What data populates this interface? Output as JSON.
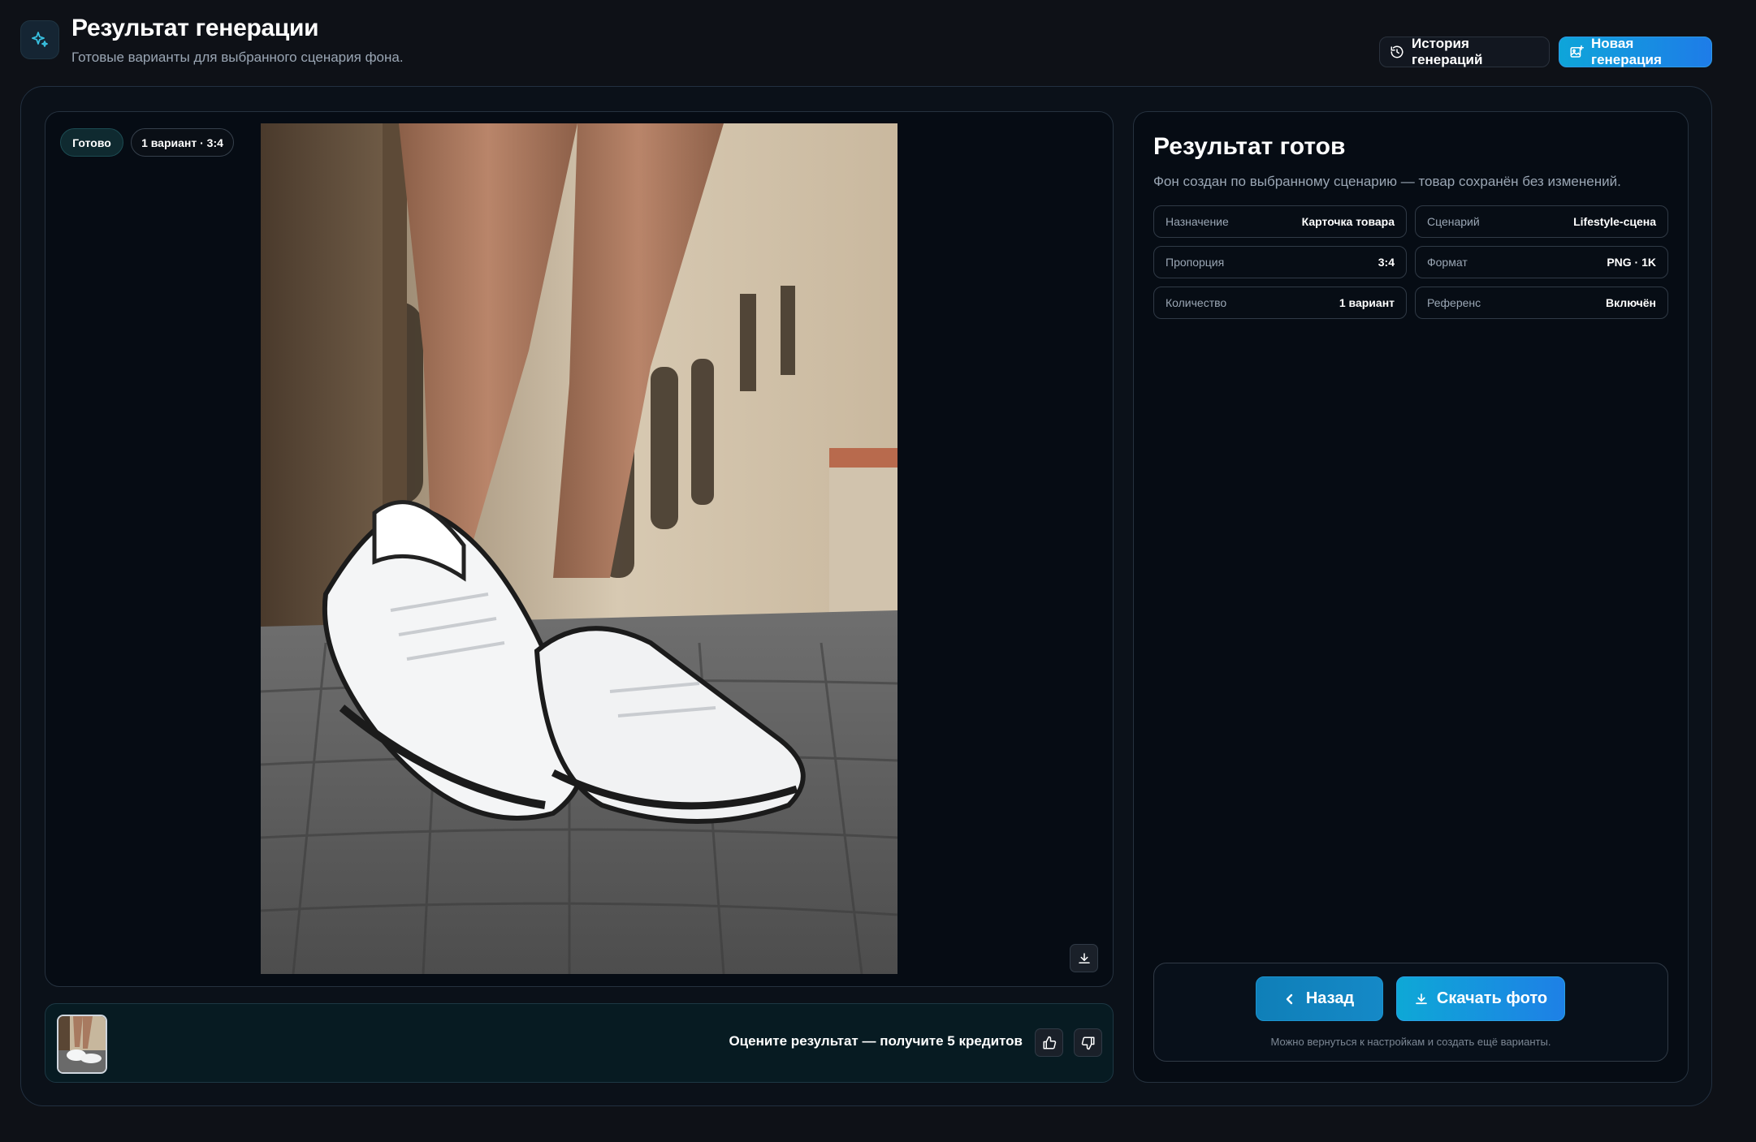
{
  "header": {
    "title": "Результат генерации",
    "subtitle": "Готовые варианты для выбранного сценария фона.",
    "app_icon": "sparkles-icon",
    "history_button": "История генераций",
    "history_icon": "history-icon",
    "new_button": "Новая генерация",
    "new_icon": "image-plus-icon"
  },
  "preview": {
    "status_chip": "Готово",
    "variant_chip": "1 вариант · 3:4",
    "image_alt": "White sneakers on cobblestone street",
    "download_icon": "download-icon"
  },
  "rating": {
    "text": "Оцените результат — получите 5 кредитов",
    "like_icon": "thumbs-up-icon",
    "dislike_icon": "thumbs-down-icon"
  },
  "info": {
    "title": "Результат готов",
    "description": "Фон создан по выбранному сценарию — товар сохранён без изменений.",
    "params": [
      {
        "label": "Назначение",
        "value": "Карточка товара"
      },
      {
        "label": "Сценарий",
        "value": "Lifestyle-сцена"
      },
      {
        "label": "Пропорция",
        "value": "3:4"
      },
      {
        "label": "Формат",
        "value": "PNG · 1K"
      },
      {
        "label": "Количество",
        "value": "1 вариант"
      },
      {
        "label": "Референс",
        "value": "Включён"
      }
    ]
  },
  "actions": {
    "back": "Назад",
    "download": "Скачать фото",
    "hint": "Можно вернуться к настройкам и создать ещё варианты."
  },
  "colors": {
    "background": "#0e1117",
    "accent": "#1589c7",
    "accent_gradient_end": "#1e80e6"
  }
}
